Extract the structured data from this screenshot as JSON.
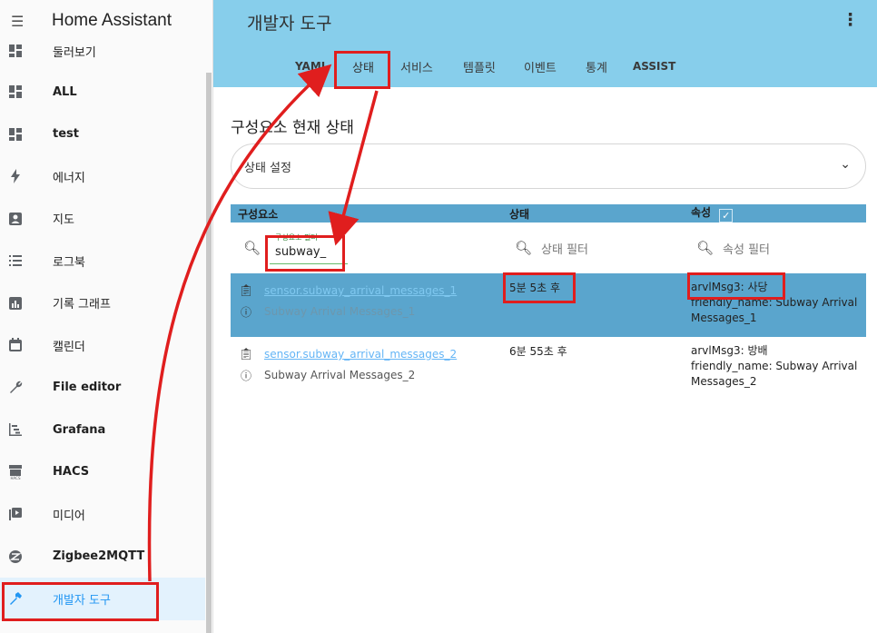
{
  "sidebar": {
    "title": "Home Assistant",
    "items": [
      {
        "label": "둘러보기",
        "icon": "dashboard-icon"
      },
      {
        "label": "ALL",
        "icon": "dashboard-icon"
      },
      {
        "label": "test",
        "icon": "dashboard-icon"
      },
      {
        "label": "에너지",
        "icon": "lightning-bolt-icon"
      },
      {
        "label": "지도",
        "icon": "account-box-icon"
      },
      {
        "label": "로그북",
        "icon": "format-list-bulleted-icon"
      },
      {
        "label": "기록 그래프",
        "icon": "chart-box-icon"
      },
      {
        "label": "캘린더",
        "icon": "calendar-icon"
      },
      {
        "label": "File editor",
        "icon": "wrench-icon"
      },
      {
        "label": "Grafana",
        "icon": "chart-gantt-icon"
      },
      {
        "label": "HACS",
        "icon": "hacs-store-icon"
      },
      {
        "label": "미디어",
        "icon": "play-box-multiple-icon"
      },
      {
        "label": "Zigbee2MQTT",
        "icon": "zigbee-icon"
      },
      {
        "label": "개발자 도구",
        "icon": "hammer-icon"
      }
    ]
  },
  "header": {
    "title": "개발자 도구",
    "tabs": [
      "YAML",
      "상태",
      "서비스",
      "템플릿",
      "이벤트",
      "통계",
      "ASSIST"
    ]
  },
  "main": {
    "section_title": "구성요소 현재 상태",
    "select_label": "상태 설정",
    "columns": [
      "구성요소",
      "상태",
      "속성"
    ],
    "filters": {
      "entity_label": "구성요소 필터",
      "entity_value": "subway_",
      "state_placeholder": "상태 필터",
      "attr_placeholder": "속성 필터"
    },
    "rows": [
      {
        "entity_id": "sensor.subway_arrival_messages_1",
        "friendly": "Subway Arrival Messages_1",
        "state": "5분 5초 후",
        "attr1": "arvlMsg3: 사당",
        "attr2": "friendly_name: Subway Arrival Messages_1"
      },
      {
        "entity_id": "sensor.subway_arrival_messages_2",
        "friendly": "Subway Arrival Messages_2",
        "state": "6분 55초 후",
        "attr1": "arvlMsg3: 방배",
        "attr2": "friendly_name: Subway Arrival Messages_2"
      }
    ]
  },
  "colors": {
    "header_bg": "#87ceeb",
    "table_header_bg": "#5aa5cd",
    "annotation": "#e01e1e",
    "active_accent": "#2196f3"
  }
}
